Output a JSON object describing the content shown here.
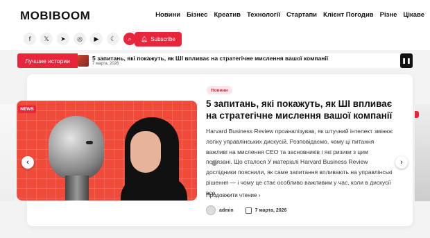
{
  "header": {
    "logo": "MOBIBOOM",
    "nav": [
      "Новини",
      "Бізнес",
      "Креатив",
      "Технології",
      "Стартапи",
      "Клієнт Погодив",
      "Різне",
      "Цікаве"
    ],
    "social_icons": [
      "facebook-icon",
      "x-icon",
      "telegram-icon",
      "instagram-icon",
      "youtube-icon",
      "moon-icon"
    ],
    "search_icon": "search-icon",
    "subscribe_label": "Subscribe"
  },
  "ticker": {
    "label": "Лучшие истории",
    "title": "5 запитань, які покажуть, як ШІ впливає на стратегічне мислення вашої компанії",
    "date": "7 марта, 2026"
  },
  "featured": {
    "badge": "NEWS",
    "category": "Новини",
    "title": "5 запитань, які покажуть, як ШІ впливає на стратегічне мислення вашої компанії",
    "excerpt": "Harvard Business Review проаналізував, як штучний інтелект змінює логіку управлінських дискусій. Розповідаємо, чому ці питання важливі на мислення CEO та засновників і які ризики з цим пов'язані. Що сталося У матеріалі Harvard Business Review дослідники пояснили, як саме запитання впливають на управлінські рішення — і чому це стає особливо важливим у час, коли в дискусії все",
    "read_more": "Продовжити чтение",
    "author": "admin",
    "date": "7 марта, 2026"
  },
  "colors": {
    "accent": "#e8253b",
    "hero_bg": "#f04a3a"
  }
}
